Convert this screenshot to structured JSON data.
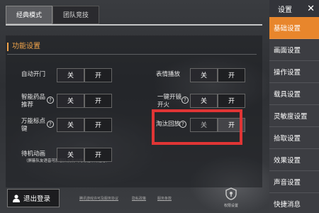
{
  "tabs": [
    "经典模式",
    "团队竞技"
  ],
  "section_title": "功能设置",
  "settings": {
    "auto_door": {
      "label": "自动开门",
      "off": "关",
      "on": "开"
    },
    "emote_play": {
      "label": "表情播放",
      "off": "关",
      "on": "开"
    },
    "smart_drug": {
      "label_line1": "智能药品",
      "label_line2": "推荐",
      "off": "关",
      "on": "开"
    },
    "one_key_scope": {
      "label_line1": "一键开镜",
      "label_line2": "开火",
      "off": "关",
      "on": "开"
    },
    "universal_mark": {
      "label_line1": "万能标点",
      "label_line2": "键",
      "off": "关",
      "on": "开"
    },
    "elim_replay": {
      "label": "淘汰回放",
      "off": "关",
      "on": "开"
    },
    "idle_anim": {
      "label": "待机动画",
      "off": "关",
      "on": "开"
    }
  },
  "note": "（屏蔽队友语音可屏蔽队友发出的万能标点信息）",
  "logout_label": "退出登录",
  "links": [
    "腾讯游戏许可及服务协议",
    "隐私政策",
    "服务条款"
  ],
  "permission_label": "权限设置",
  "sidebar": {
    "title": "设置",
    "close": "✕",
    "items": [
      "基础设置",
      "画面设置",
      "操作设置",
      "载具设置",
      "灵敏度设置",
      "拾取设置",
      "效果设置",
      "声音设置",
      "快捷消息"
    ],
    "active_index": 0
  },
  "colors": {
    "accent": "#e8862c",
    "section": "#f0a34a",
    "highlight_box": "#e03535"
  }
}
